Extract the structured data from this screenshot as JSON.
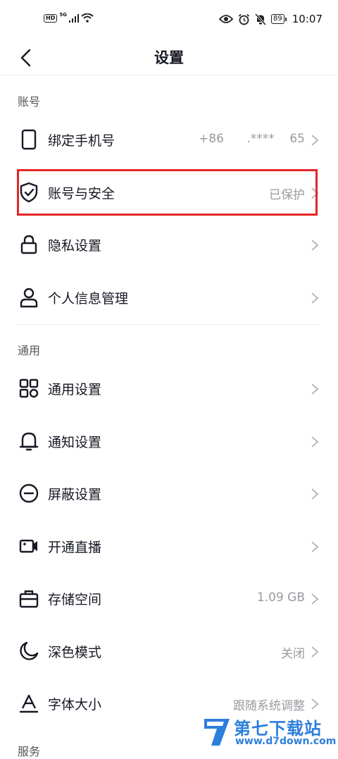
{
  "status_bar": {
    "hd": "HD",
    "network": "5G",
    "battery": "89",
    "time": "10:07"
  },
  "nav": {
    "title": "设置"
  },
  "sections": {
    "account": "账号",
    "general": "通用",
    "service": "服务"
  },
  "rows": [
    {
      "label": "绑定手机号",
      "value": "+86      .****    65"
    },
    {
      "label": "账号与安全",
      "value": "已保护"
    },
    {
      "label": "隐私设置",
      "value": ""
    },
    {
      "label": "个人信息管理",
      "value": ""
    },
    {
      "label": "通用设置",
      "value": ""
    },
    {
      "label": "通知设置",
      "value": ""
    },
    {
      "label": "屏蔽设置",
      "value": ""
    },
    {
      "label": "开通直播",
      "value": ""
    },
    {
      "label": "存储空间",
      "value": "1.09 GB"
    },
    {
      "label": "深色模式",
      "value": "关闭"
    },
    {
      "label": "字体大小",
      "value": "跟随系统调整"
    }
  ],
  "watermark": {
    "title": "第七下载站",
    "url": "www.d7down.com"
  },
  "colors": {
    "highlight": "#e52527",
    "watermark": "#2d7fdc"
  }
}
